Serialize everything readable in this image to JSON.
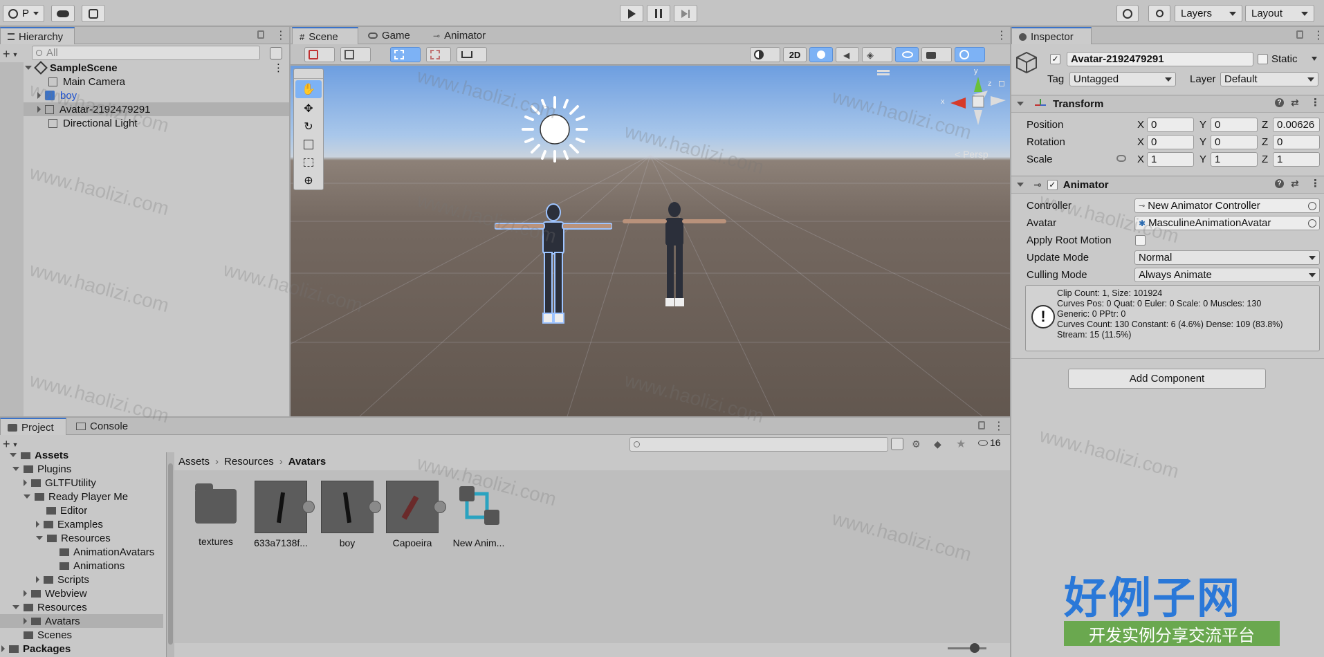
{
  "toolbar": {
    "account_label": "P",
    "layers_label": "Layers",
    "layout_label": "Layout"
  },
  "hierarchy": {
    "tab_label": "Hierarchy",
    "search_placeholder": "All",
    "items": [
      {
        "label": "SampleScene"
      },
      {
        "label": "Main Camera"
      },
      {
        "label": "boy"
      },
      {
        "label": "Avatar-2192479291"
      },
      {
        "label": "Directional Light"
      }
    ]
  },
  "scene": {
    "tabs": [
      {
        "label": "Scene"
      },
      {
        "label": "Game"
      },
      {
        "label": "Animator"
      }
    ],
    "mode_2d_label": "2D",
    "persp_label": "< Persp",
    "gizmo_axes": {
      "y": "y",
      "x": "x",
      "z": "z"
    }
  },
  "inspector": {
    "tab_label": "Inspector",
    "object_name": "Avatar-2192479291",
    "static_label": "Static",
    "tag_label": "Tag",
    "tag_value": "Untagged",
    "layer_label": "Layer",
    "layer_value": "Default",
    "transform": {
      "title": "Transform",
      "position_label": "Position",
      "rotation_label": "Rotation",
      "scale_label": "Scale",
      "axis_x": "X",
      "axis_y": "Y",
      "axis_z": "Z",
      "position": {
        "x": "0",
        "y": "0",
        "z": "0.00626"
      },
      "rotation": {
        "x": "0",
        "y": "0",
        "z": "0"
      },
      "scale": {
        "x": "1",
        "y": "1",
        "z": "1"
      }
    },
    "animator": {
      "title": "Animator",
      "controller_label": "Controller",
      "controller_value": "New Animator Controller",
      "avatar_label": "Avatar",
      "avatar_value": "MasculineAnimationAvatar",
      "apply_root_motion_label": "Apply Root Motion",
      "update_mode_label": "Update Mode",
      "update_mode_value": "Normal",
      "culling_mode_label": "Culling Mode",
      "culling_mode_value": "Always Animate",
      "info_lines": [
        "Clip Count: 1, Size: 101924",
        "Curves Pos: 0 Quat: 0 Euler: 0 Scale: 0 Muscles: 130",
        "Generic: 0 PPtr: 0",
        "Curves Count: 130 Constant: 6 (4.6%) Dense: 109 (83.8%)",
        "Stream: 15 (11.5%)"
      ]
    },
    "add_component_label": "Add Component"
  },
  "project": {
    "tabs": [
      {
        "label": "Project"
      },
      {
        "label": "Console"
      }
    ],
    "hidden_count": "16",
    "tree": [
      {
        "label": "Assets"
      },
      {
        "label": "Plugins"
      },
      {
        "label": "GLTFUtility"
      },
      {
        "label": "Ready Player Me"
      },
      {
        "label": "Editor"
      },
      {
        "label": "Examples"
      },
      {
        "label": "Resources"
      },
      {
        "label": "AnimationAvatars"
      },
      {
        "label": "Animations"
      },
      {
        "label": "Scripts"
      },
      {
        "label": "Webview"
      },
      {
        "label": "Resources"
      },
      {
        "label": "Avatars"
      },
      {
        "label": "Scenes"
      },
      {
        "label": "Packages"
      }
    ],
    "breadcrumb": [
      "Assets",
      "Resources",
      "Avatars"
    ],
    "assets": [
      {
        "label": "textures"
      },
      {
        "label": "633a7138f..."
      },
      {
        "label": "boy"
      },
      {
        "label": "Capoeira"
      },
      {
        "label": "New Anim..."
      }
    ]
  },
  "watermark": {
    "text": "www.haolizi.com",
    "logo_main": "好例子网",
    "logo_sub": "开发实例分享交流平台"
  },
  "colors": {
    "accent": "#3a72c8",
    "panel": "#c8c8c8",
    "sky_top": "#6d9ee0",
    "ground": "#6a5e55"
  }
}
